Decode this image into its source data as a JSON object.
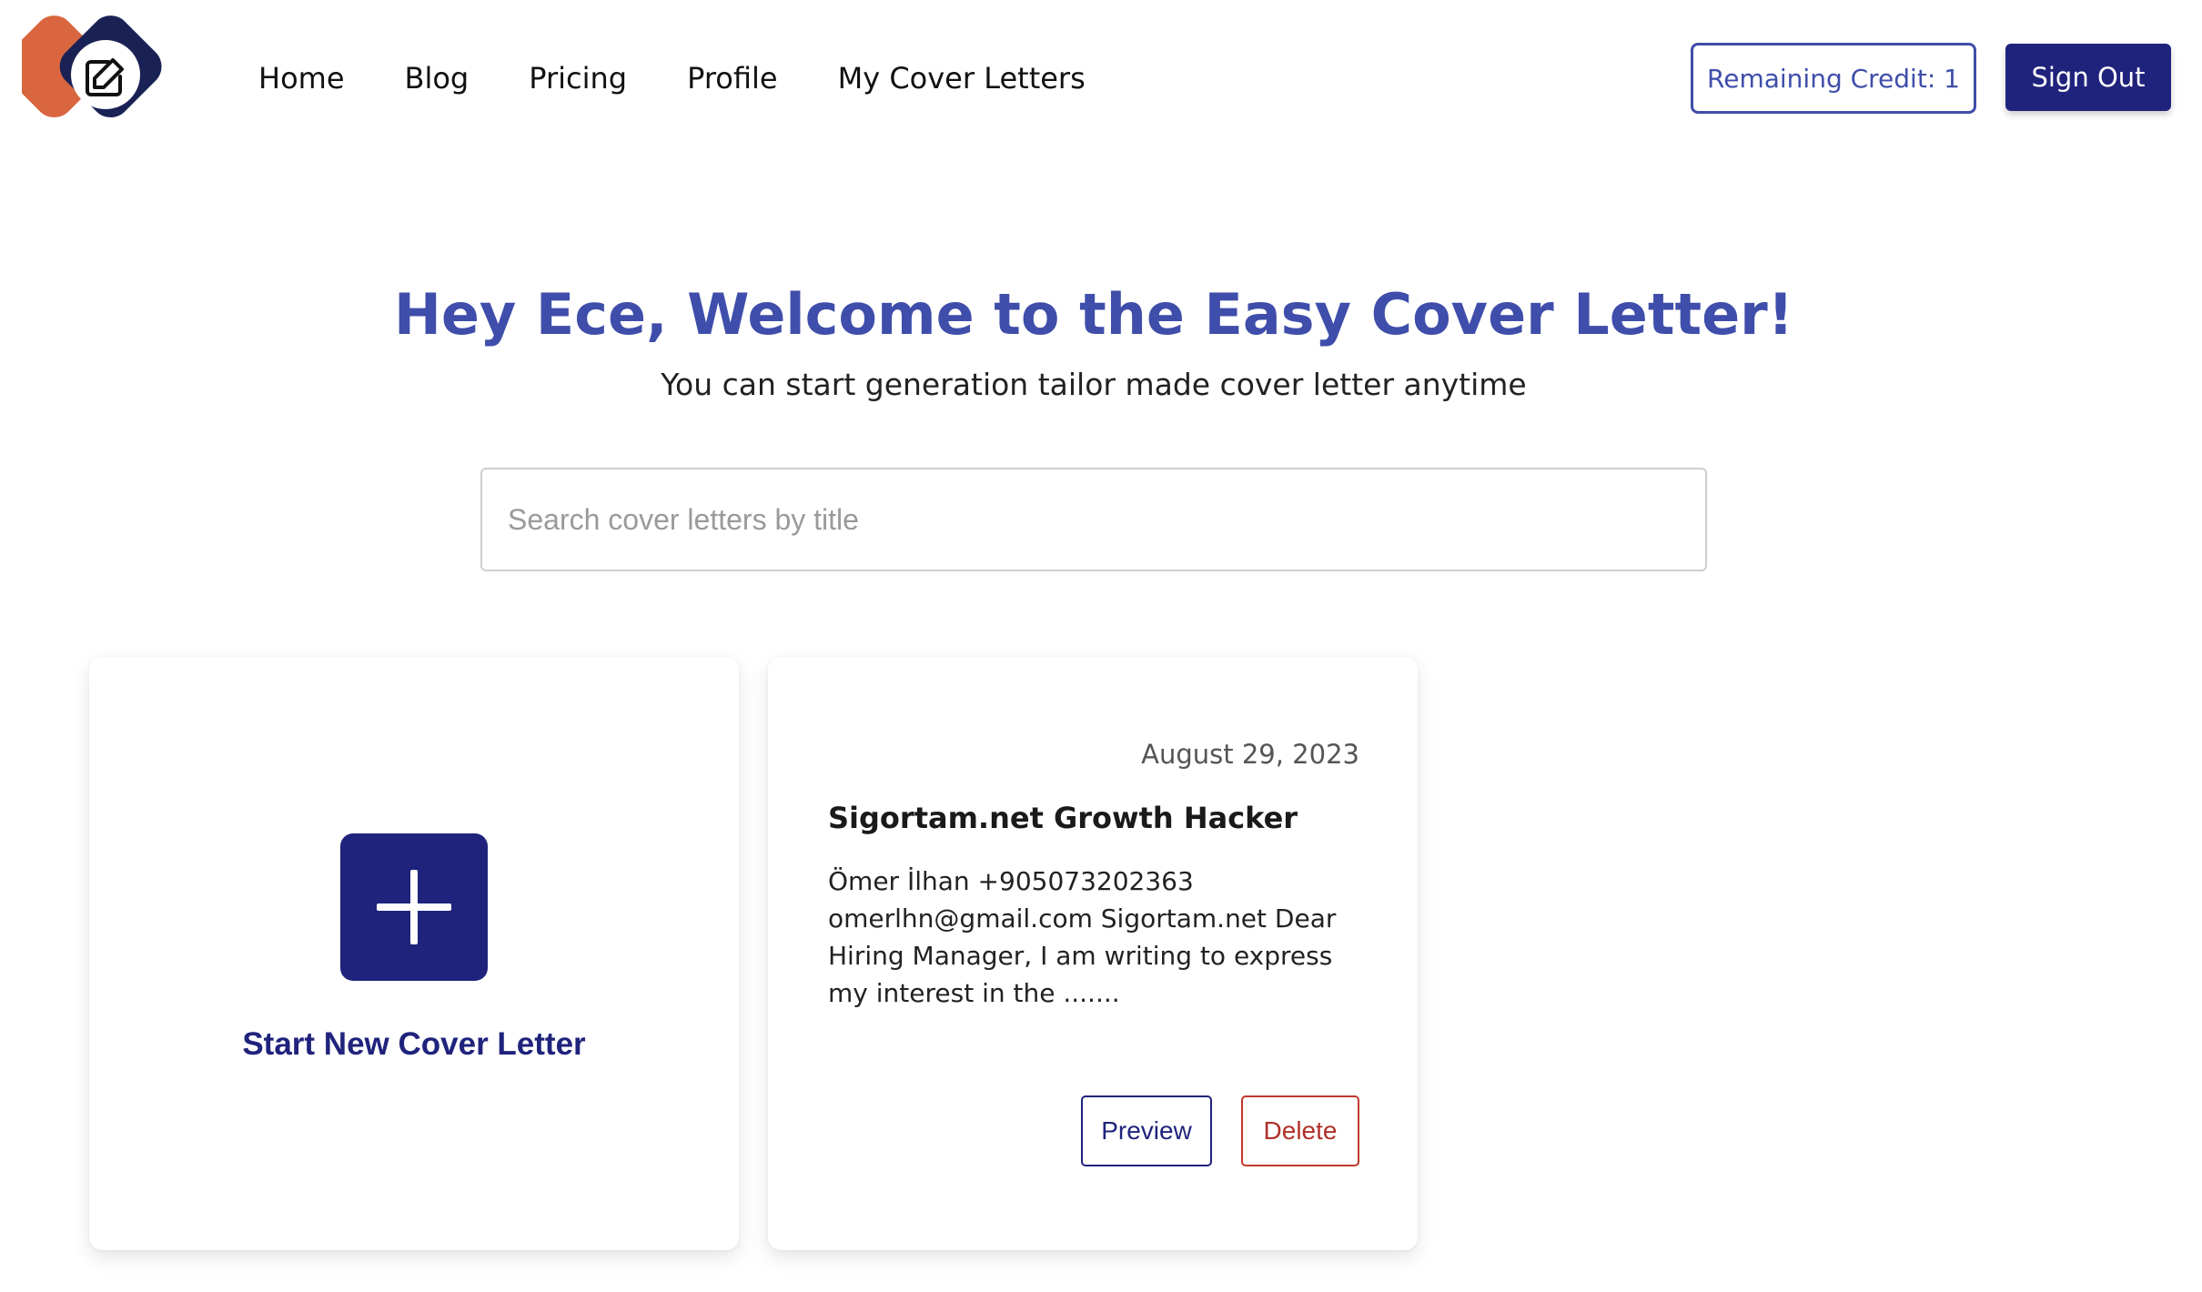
{
  "header": {
    "nav": [
      {
        "label": "Home"
      },
      {
        "label": "Blog"
      },
      {
        "label": "Pricing"
      },
      {
        "label": "Profile"
      },
      {
        "label": "My Cover Letters"
      }
    ],
    "credit_label": "Remaining Credit: 1",
    "signout_label": "Sign Out",
    "logo_icon": "edit-pencil-icon",
    "colors": {
      "brand_orange": "#d9663f",
      "brand_navy": "#1a2255"
    }
  },
  "hero": {
    "title": "Hey Ece, Welcome to the Easy Cover Letter!",
    "subtitle": "You can start generation tailor made cover letter anytime",
    "title_color": "#3f4eaa"
  },
  "search": {
    "placeholder": "Search cover letters by title",
    "value": ""
  },
  "new_card": {
    "icon": "plus-icon",
    "label": "Start New Cover Letter"
  },
  "letters": [
    {
      "date": "August 29, 2023",
      "title": "Sigortam.net Growth Hacker",
      "excerpt": "Ömer İlhan +905073202363 omerlhn@gmail.com Sigortam.net Dear Hiring Manager, I am writing to express my interest in the .......",
      "preview_label": "Preview",
      "delete_label": "Delete"
    }
  ],
  "colors": {
    "primary": "#1f237c",
    "accent": "#3f4eaa",
    "danger": "#b03028"
  }
}
